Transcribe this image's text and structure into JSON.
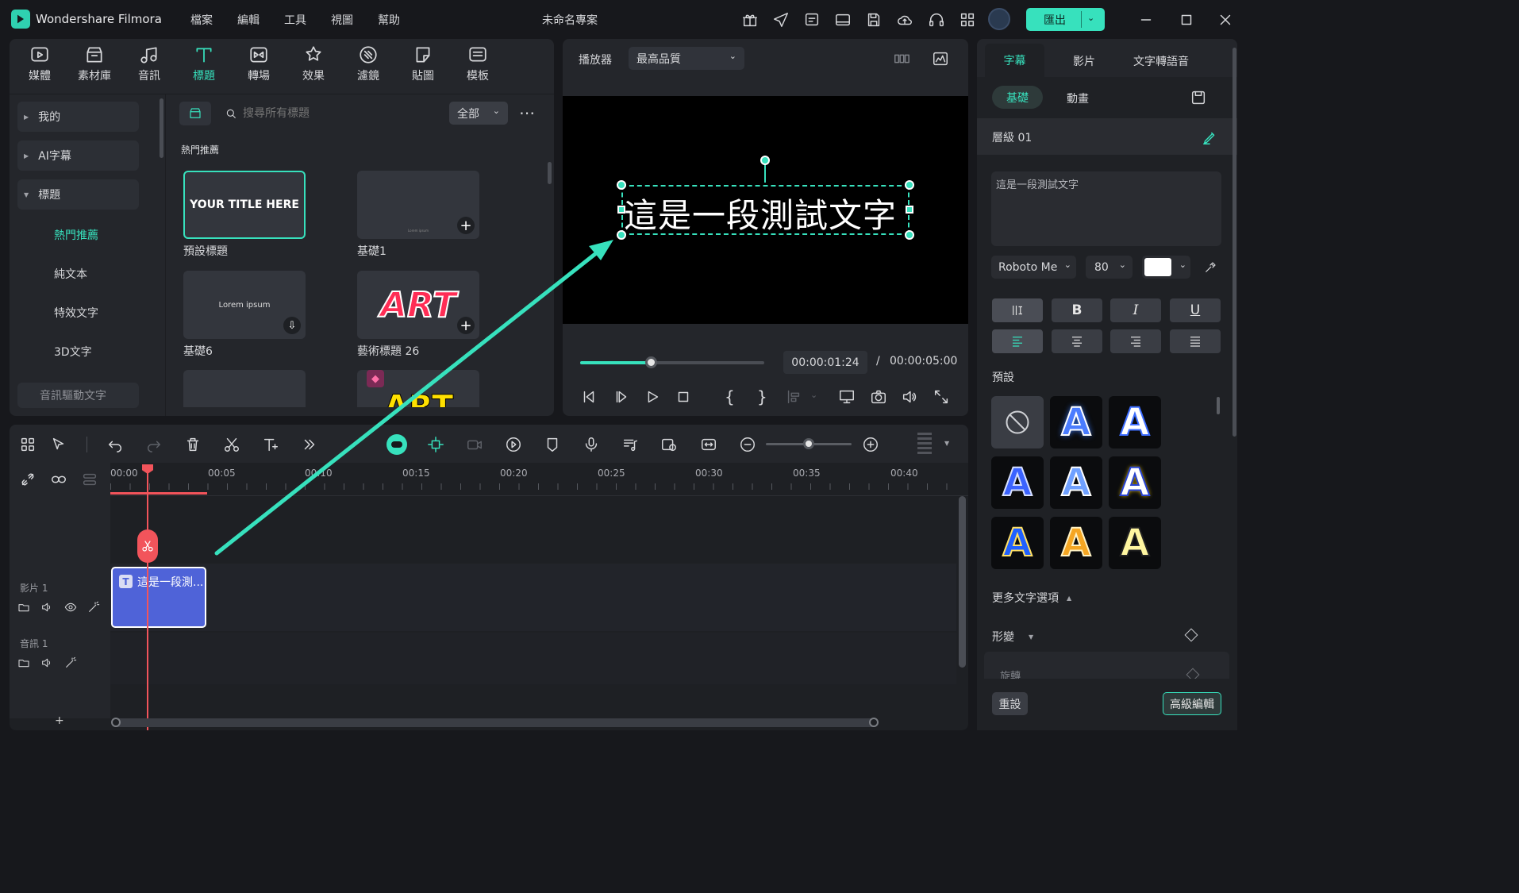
{
  "app": {
    "name": "Wondershare Filmora",
    "project_title": "未命名專案",
    "export_label": "匯出"
  },
  "menu": [
    "檔案",
    "編輯",
    "工具",
    "視圖",
    "幫助"
  ],
  "toolbar_tabs": [
    {
      "label": "媒體",
      "icon": "media-icon"
    },
    {
      "label": "素材庫",
      "icon": "library-icon"
    },
    {
      "label": "音訊",
      "icon": "music-icon"
    },
    {
      "label": "標題",
      "icon": "title-icon",
      "active": true
    },
    {
      "label": "轉場",
      "icon": "transition-icon"
    },
    {
      "label": "效果",
      "icon": "effects-icon"
    },
    {
      "label": "濾鏡",
      "icon": "filter-icon"
    },
    {
      "label": "貼圖",
      "icon": "sticker-icon"
    },
    {
      "label": "模板",
      "icon": "template-icon"
    }
  ],
  "sidebar": {
    "items": [
      "我的",
      "AI字幕",
      "標題"
    ],
    "subitems": [
      "熱門推薦",
      "純文本",
      "特效文字",
      "3D文字"
    ],
    "bottom": "音訊驅動文字"
  },
  "browser": {
    "search_placeholder": "搜尋所有標題",
    "filter": "全部",
    "section": "熱門推薦",
    "cards": [
      {
        "label": "預設標題",
        "preview": "YOUR TITLE HERE"
      },
      {
        "label": "基礎1",
        "preview": "Lorem ipsum"
      },
      {
        "label": "基礎6",
        "preview": "Lorem ipsum"
      },
      {
        "label": "藝術標題 26",
        "preview": "ART"
      }
    ]
  },
  "player": {
    "label": "播放器",
    "quality": "最高品質",
    "preview_text": "這是一段測試文字",
    "current_time": "00:00:01:24",
    "separator": "/",
    "total_time": "00:00:05:00",
    "progress": 0.39
  },
  "timeline": {
    "ticks": [
      "00:00",
      "00:05",
      "00:10",
      "00:15",
      "00:20",
      "00:25",
      "00:30",
      "00:35",
      "00:40"
    ],
    "tracks": [
      "影片 1",
      "音訊 1"
    ],
    "clip_label": "這是一段測...",
    "add_label": "+"
  },
  "inspector": {
    "tabs": [
      "字幕",
      "影片",
      "文字轉語音"
    ],
    "subtabs": [
      "基礎",
      "動畫"
    ],
    "layer": "層級 01",
    "text_value": "這是一段測試文字",
    "font": "Roboto Me",
    "size": "80",
    "color": "#ffffff",
    "presets_label": "預設",
    "more_label": "更多文字選項",
    "transform_label": "形變",
    "rotate_label": "旋轉",
    "reset_label": "重設",
    "advanced_label": "高級編輯"
  },
  "colors": {
    "accent": "#37e1bd",
    "playhead": "#f2545b",
    "clip": "#4f63d8"
  }
}
